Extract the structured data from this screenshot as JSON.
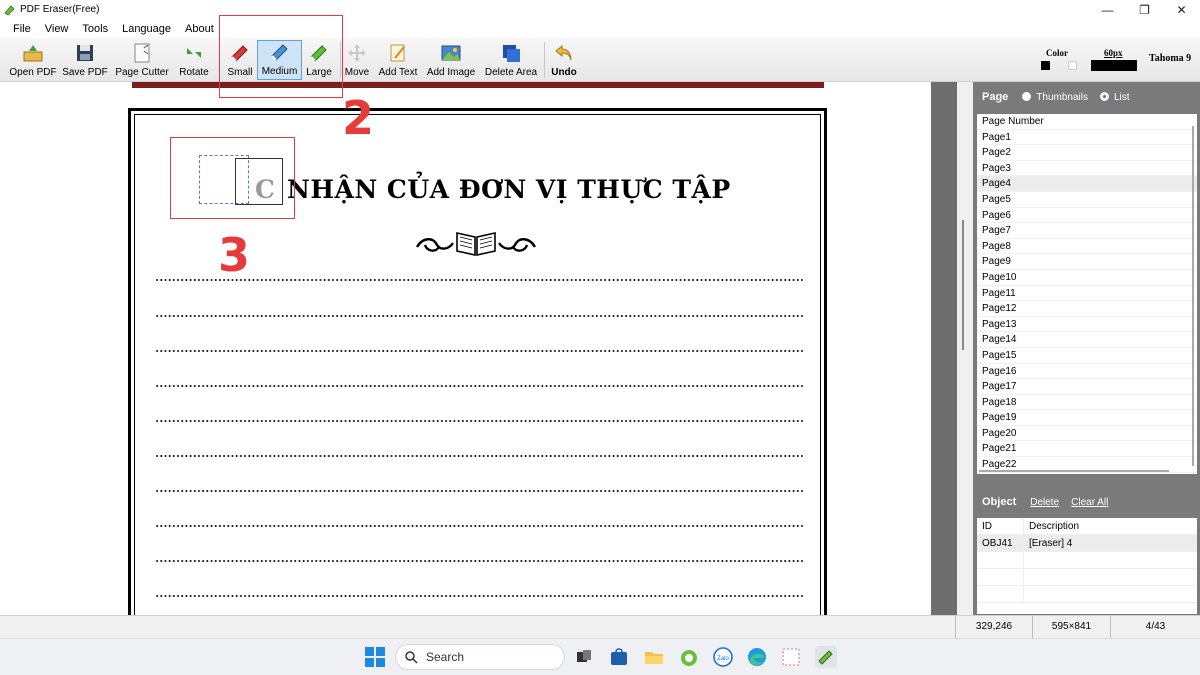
{
  "window": {
    "title": "PDF Eraser(Free)",
    "controls": [
      "—",
      "❐",
      "✕"
    ]
  },
  "menu": [
    "File",
    "View",
    "Tools",
    "Language",
    "About"
  ],
  "toolbar": {
    "open_pdf": "Open PDF",
    "save_pdf": "Save PDF",
    "page_cutter": "Page Cutter",
    "rotate": "Rotate",
    "small": "Small",
    "medium": "Medium",
    "large": "Large",
    "move": "Move",
    "add_text": "Add Text",
    "add_image": "Add Image",
    "delete_area": "Delete Area",
    "undo": "Undo",
    "active_tool": "Medium"
  },
  "settings": {
    "color_label": "Color",
    "size_label": "60px",
    "font_label": "Tahoma 9",
    "colors": [
      "#000000",
      "#ffffff"
    ]
  },
  "document": {
    "title_text": "NHẬN CỦA ĐƠN VỊ THỰC TẬP",
    "erased_letter": "C",
    "dotted_line_count": 10
  },
  "annotations": {
    "marker2": "2",
    "marker3": "3",
    "color": "#e53b3b"
  },
  "page_panel": {
    "title": "Page",
    "thumbnails_label": "Thumbnails",
    "list_label": "List",
    "selected_view": "List",
    "header": "Page Number",
    "pages": [
      "Page1",
      "Page2",
      "Page3",
      "Page4",
      "Page5",
      "Page6",
      "Page7",
      "Page8",
      "Page9",
      "Page10",
      "Page11",
      "Page12",
      "Page13",
      "Page14",
      "Page15",
      "Page16",
      "Page17",
      "Page18",
      "Page19",
      "Page20",
      "Page21",
      "Page22"
    ],
    "selected_page": "Page4"
  },
  "object_panel": {
    "title": "Object",
    "delete_label": "Delete",
    "clear_all_label": "Clear All",
    "columns": [
      "ID",
      "Description"
    ],
    "rows": [
      {
        "id": "OBJ41",
        "description": "[Eraser] 4"
      }
    ]
  },
  "status": {
    "coords": "329,246",
    "page_size": "595×841",
    "page_index": "4/43"
  },
  "taskbar": {
    "search_label": "Search"
  }
}
